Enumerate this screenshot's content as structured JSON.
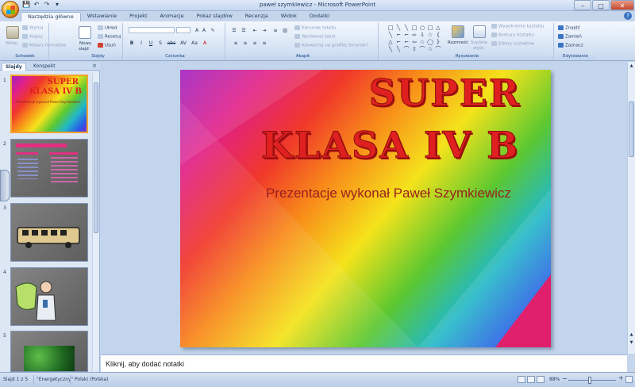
{
  "window": {
    "title": "paweł szymkiewicz - Microsoft PowerPoint",
    "controls": [
      "–",
      "□",
      "✕"
    ]
  },
  "quick_access": [
    "💾",
    "↶",
    "↷",
    "▾"
  ],
  "tabs": [
    {
      "label": "Narzędzia główne",
      "active": true
    },
    {
      "label": "Wstawianie"
    },
    {
      "label": "Projekt"
    },
    {
      "label": "Animacje"
    },
    {
      "label": "Pokaz slajdów"
    },
    {
      "label": "Recenzja"
    },
    {
      "label": "Widok"
    },
    {
      "label": "Dodatki"
    }
  ],
  "ribbon": {
    "groups": {
      "clipboard": "Schowek",
      "slides": "Slajdy",
      "font": "Czcionka",
      "paragraph": "Akapit",
      "drawing": "Rysowanie",
      "editing": "Edytowanie"
    },
    "clipboard": {
      "paste": "Wklej",
      "cut": "Wytnij",
      "copy": "Kopiuj",
      "format_painter": "Malarz formatów"
    },
    "slides": {
      "new_slide_1": "Nowy",
      "new_slide_2": "slajd",
      "layout": "Układ",
      "reset": "Resetuj",
      "delete": "Usuń"
    },
    "font_buttons": [
      "B",
      "I",
      "U",
      "S",
      "abc",
      "AV",
      "Aa",
      "A"
    ],
    "paragraph": {
      "text_direction": "Kierunek tekstu",
      "align_text": "Wyrównaj tekst",
      "smartart": "Konwertuj na grafikę SmartArt"
    },
    "drawing": {
      "arrange_1": "Rozmieść",
      "quick_styles_1": "Szybkie",
      "quick_styles_2": "style",
      "shape_fill": "Wypełnienie kształtu",
      "shape_outline": "Kontury kształtu",
      "shape_effects": "Efekty kształtów"
    },
    "editing": {
      "find": "Znajdź",
      "replace": "Zamień",
      "select": "Zaznacz"
    },
    "shapes": [
      "□",
      "╲",
      "╲",
      "□",
      "○",
      "□",
      "△",
      "╲",
      "⌐",
      "⌐",
      "⇨",
      "⇩",
      "☆",
      "{",
      "△",
      "⌐",
      "⌐",
      "⇦",
      "☆",
      "◯",
      "}",
      "╲",
      "╲",
      "⌒",
      "⇧",
      "⌒",
      "☆",
      "⌒"
    ]
  },
  "pane": {
    "tabs": [
      "Slajdy",
      "Konspekt"
    ],
    "close": "×",
    "slides": [
      {
        "num": "1",
        "title": "SUPER",
        "title2": "KLASA IV B",
        "sub": "Prezentacje wykonał Paweł Szymkiewicz"
      },
      {
        "num": "2"
      },
      {
        "num": "3"
      },
      {
        "num": "4"
      },
      {
        "num": "5"
      }
    ]
  },
  "slide": {
    "title_line1": "SUPER",
    "title_line2": "KLASA IV B",
    "subtitle": "Prezentacje wykonał Paweł Szymkiewicz"
  },
  "notes": {
    "placeholder": "Kliknij, aby dodać notatki"
  },
  "status": {
    "slide": "Slajd 1 z 5",
    "theme": "\"Energetyczny\"",
    "language": "Polski (Polska)",
    "zoom": "88%"
  },
  "colors": {
    "title_red": "#e02020",
    "subtitle": "#9a2020",
    "accent_orange": "#f4a330",
    "ribbon_blue": "#dbe7f6"
  }
}
